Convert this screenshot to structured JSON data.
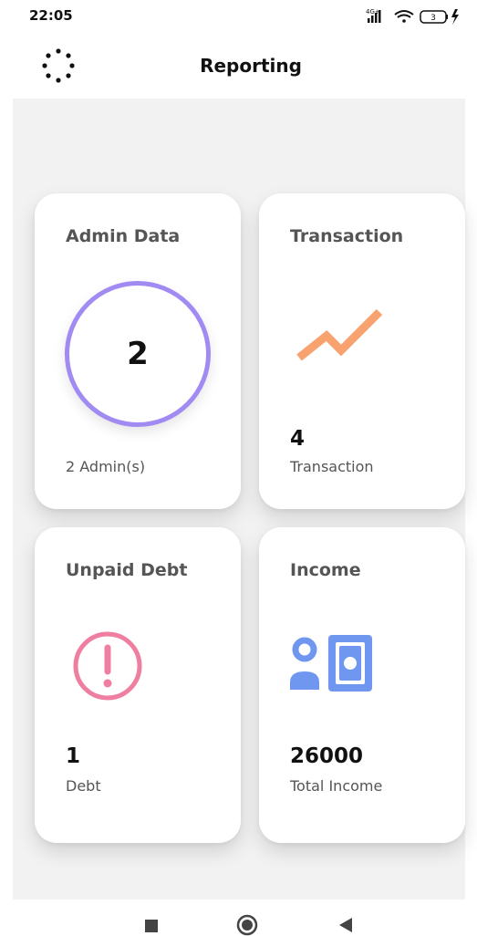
{
  "status_bar": {
    "time": "22:05",
    "network": "4G+",
    "battery": "3"
  },
  "header": {
    "title": "Reporting",
    "menu_icon": "dots-circle-icon"
  },
  "cards": {
    "admin": {
      "title": "Admin Data",
      "value": "2",
      "caption": "2 Admin(s)",
      "ring_color": "#a18af2"
    },
    "transaction": {
      "title": "Transaction",
      "value": "4",
      "caption": "Transaction",
      "icon": "trending-up-icon",
      "icon_color": "#f7a26f"
    },
    "debt": {
      "title": "Unpaid Debt",
      "value": "1",
      "caption": "Debt",
      "icon": "alert-circle-icon",
      "icon_color": "#ef7fa0"
    },
    "income": {
      "title": "Income",
      "value": "26000",
      "caption": "Total Income",
      "icon": "user-money-icon",
      "icon_color": "#6f97f0"
    }
  },
  "nav_bar": {
    "items": [
      "recents-square-icon",
      "home-circle-icon",
      "back-triangle-icon"
    ]
  }
}
